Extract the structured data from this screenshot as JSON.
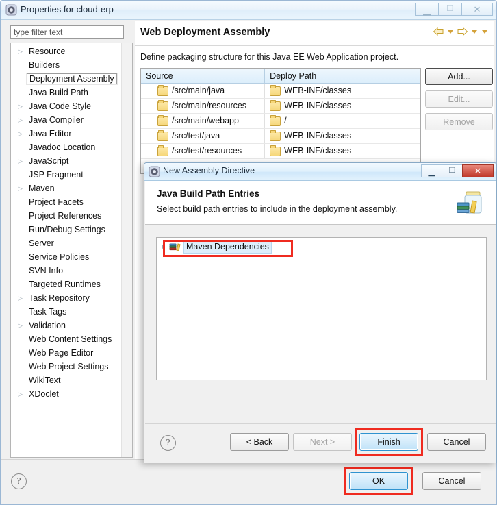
{
  "outer_window": {
    "title": "Properties for cloud-erp",
    "icon": "eclipse-properties-icon",
    "buttons": {
      "minimize": "minimize-icon",
      "maximize": "maximize-icon",
      "close": "close-icon"
    }
  },
  "filter": {
    "placeholder": "type filter text",
    "value": ""
  },
  "sidebar": {
    "items": [
      {
        "label": "Resource",
        "expandable": true,
        "selected": false
      },
      {
        "label": "Builders",
        "expandable": false,
        "selected": false
      },
      {
        "label": "Deployment Assembly",
        "expandable": false,
        "selected": true
      },
      {
        "label": "Java Build Path",
        "expandable": false,
        "selected": false
      },
      {
        "label": "Java Code Style",
        "expandable": true,
        "selected": false
      },
      {
        "label": "Java Compiler",
        "expandable": true,
        "selected": false
      },
      {
        "label": "Java Editor",
        "expandable": true,
        "selected": false
      },
      {
        "label": "Javadoc Location",
        "expandable": false,
        "selected": false
      },
      {
        "label": "JavaScript",
        "expandable": true,
        "selected": false
      },
      {
        "label": "JSP Fragment",
        "expandable": false,
        "selected": false
      },
      {
        "label": "Maven",
        "expandable": true,
        "selected": false
      },
      {
        "label": "Project Facets",
        "expandable": false,
        "selected": false
      },
      {
        "label": "Project References",
        "expandable": false,
        "selected": false
      },
      {
        "label": "Run/Debug Settings",
        "expandable": false,
        "selected": false
      },
      {
        "label": "Server",
        "expandable": false,
        "selected": false
      },
      {
        "label": "Service Policies",
        "expandable": false,
        "selected": false
      },
      {
        "label": "SVN Info",
        "expandable": false,
        "selected": false
      },
      {
        "label": "Targeted Runtimes",
        "expandable": false,
        "selected": false
      },
      {
        "label": "Task Repository",
        "expandable": true,
        "selected": false
      },
      {
        "label": "Task Tags",
        "expandable": false,
        "selected": false
      },
      {
        "label": "Validation",
        "expandable": true,
        "selected": false
      },
      {
        "label": "Web Content Settings",
        "expandable": false,
        "selected": false
      },
      {
        "label": "Web Page Editor",
        "expandable": false,
        "selected": false
      },
      {
        "label": "Web Project Settings",
        "expandable": false,
        "selected": false
      },
      {
        "label": "WikiText",
        "expandable": false,
        "selected": false
      },
      {
        "label": "XDoclet",
        "expandable": true,
        "selected": false
      }
    ]
  },
  "main": {
    "page_title": "Web Deployment Assembly",
    "description": "Define packaging structure for this Java EE Web Application project.",
    "nav": {
      "back_icon": "back-arrow-icon",
      "back_menu_icon": "chevron-down-icon",
      "forward_icon": "forward-arrow-icon",
      "forward_menu_icon": "chevron-down-icon",
      "more_icon": "chevron-down-icon"
    },
    "table": {
      "columns": [
        "Source",
        "Deploy Path"
      ],
      "sort_column": "Source",
      "rows": [
        {
          "source": "/src/main/java",
          "deploy": "WEB-INF/classes"
        },
        {
          "source": "/src/main/resources",
          "deploy": "WEB-INF/classes"
        },
        {
          "source": "/src/main/webapp",
          "deploy": "/"
        },
        {
          "source": "/src/test/java",
          "deploy": "WEB-INF/classes"
        },
        {
          "source": "/src/test/resources",
          "deploy": "WEB-INF/classes"
        }
      ]
    },
    "buttons": {
      "add": "Add...",
      "edit": "Edit...",
      "remove": "Remove"
    }
  },
  "outer_footer": {
    "help_icon": "help-icon",
    "ok": "OK",
    "cancel": "Cancel",
    "highlight_color": "#ef2b20"
  },
  "inner_dialog": {
    "title": "New Assembly Directive",
    "icon": "eclipse-wizard-icon",
    "buttons": {
      "minimize": "minimize-icon",
      "maximize": "maximize-icon",
      "close": "close-icon"
    },
    "header": {
      "title": "Java Build Path Entries",
      "subtitle": "Select build path entries to include in the deployment assembly.",
      "banner_icon": "jar-library-icon"
    },
    "tree": {
      "items": [
        {
          "label": "Maven Dependencies",
          "expandable": true,
          "selected": true,
          "icon": "maven-dependencies-icon"
        }
      ]
    },
    "footer": {
      "help_icon": "help-icon",
      "back": "< Back",
      "next": "Next >",
      "finish": "Finish",
      "cancel": "Cancel"
    }
  }
}
